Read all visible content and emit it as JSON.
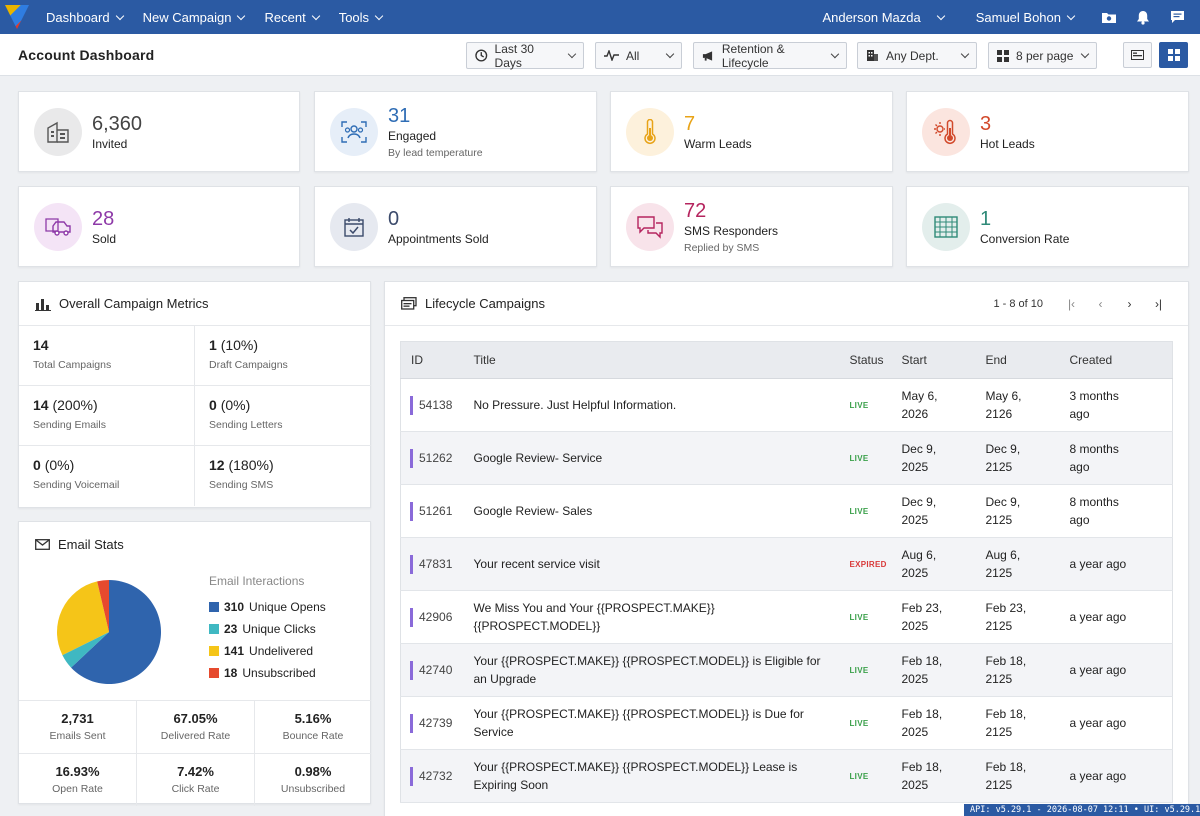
{
  "nav": {
    "items": [
      "Dashboard",
      "New Campaign",
      "Recent",
      "Tools"
    ],
    "user1": "Anderson Mazda",
    "user2": "Samuel Bohon"
  },
  "header": {
    "title": "Account Dashboard",
    "filters": {
      "date": "Last 30 Days",
      "channel": "All",
      "campaign_type": "Retention & Lifecycle",
      "department": "Any Dept.",
      "per_page": "8 per page"
    }
  },
  "stats": [
    {
      "value": "6,360",
      "label": "Invited",
      "sub": "",
      "color": "#444444",
      "icon": "building-icon"
    },
    {
      "value": "31",
      "label": "Engaged",
      "sub": "By lead temperature",
      "color": "#2f6db5",
      "icon": "people-icon"
    },
    {
      "value": "7",
      "label": "Warm Leads",
      "sub": "",
      "color": "#e8a317",
      "icon": "thermometer-icon"
    },
    {
      "value": "3",
      "label": "Hot Leads",
      "sub": "",
      "color": "#d2492b",
      "icon": "hot-thermometer-icon"
    },
    {
      "value": "28",
      "label": "Sold",
      "sub": "",
      "color": "#8e3aa8",
      "icon": "car-icon"
    },
    {
      "value": "0",
      "label": "Appointments Sold",
      "sub": "",
      "color": "#3b4a6b",
      "icon": "calendar-check-icon"
    },
    {
      "value": "72",
      "label": "SMS Responders",
      "sub": "Replied by SMS",
      "color": "#b5245e",
      "icon": "chat-icon"
    },
    {
      "value": "1",
      "label": "Conversion Rate",
      "sub": "",
      "color": "#2f8a78",
      "icon": "grid-icon"
    }
  ],
  "campaign_metrics": {
    "title": "Overall Campaign Metrics",
    "items": [
      {
        "value": "14",
        "pct": "",
        "label": "Total Campaigns"
      },
      {
        "value": "1",
        "pct": "(10%)",
        "label": "Draft Campaigns"
      },
      {
        "value": "14",
        "pct": "(200%)",
        "label": "Sending Emails"
      },
      {
        "value": "0",
        "pct": "(0%)",
        "label": "Sending Letters"
      },
      {
        "value": "0",
        "pct": "(0%)",
        "label": "Sending Voicemail"
      },
      {
        "value": "12",
        "pct": "(180%)",
        "label": "Sending SMS"
      }
    ]
  },
  "email_stats": {
    "title": "Email Stats",
    "legend_title": "Email Interactions",
    "legend": [
      {
        "value": "310",
        "label": "Unique Opens",
        "color": "#2f64ad"
      },
      {
        "value": "23",
        "label": "Unique Clicks",
        "color": "#3fb8c2"
      },
      {
        "value": "141",
        "label": "Undelivered",
        "color": "#f5c518"
      },
      {
        "value": "18",
        "label": "Unsubscribed",
        "color": "#e64a2e"
      }
    ],
    "summary": [
      {
        "value": "2,731",
        "label": "Emails Sent"
      },
      {
        "value": "67.05%",
        "label": "Delivered Rate"
      },
      {
        "value": "5.16%",
        "label": "Bounce Rate"
      },
      {
        "value": "16.93%",
        "label": "Open Rate"
      },
      {
        "value": "7.42%",
        "label": "Click Rate"
      },
      {
        "value": "0.98%",
        "label": "Unsubscribed"
      }
    ]
  },
  "chart_data": {
    "type": "pie",
    "title": "Email Interactions",
    "categories": [
      "Unique Opens",
      "Unique Clicks",
      "Undelivered",
      "Unsubscribed"
    ],
    "values": [
      310,
      23,
      141,
      18
    ],
    "colors": [
      "#2f64ad",
      "#3fb8c2",
      "#f5c518",
      "#e64a2e"
    ],
    "legend": "right"
  },
  "lifecycle": {
    "title": "Lifecycle Campaigns",
    "pager": "1 - 8 of 10",
    "columns": [
      "ID",
      "Title",
      "Status",
      "Start",
      "End",
      "Created"
    ],
    "rows": [
      {
        "id": "54138",
        "title": "No Pressure. Just Helpful Information.",
        "status": "LIVE",
        "start1": "May 6,",
        "start2": "2026",
        "end1": "May 6,",
        "end2": "2126",
        "created1": "3 months",
        "created2": "ago"
      },
      {
        "id": "51262",
        "title": "Google Review- Service",
        "status": "LIVE",
        "start1": "Dec 9,",
        "start2": "2025",
        "end1": "Dec 9,",
        "end2": "2125",
        "created1": "8 months",
        "created2": "ago"
      },
      {
        "id": "51261",
        "title": "Google Review- Sales",
        "status": "LIVE",
        "start1": "Dec 9,",
        "start2": "2025",
        "end1": "Dec 9,",
        "end2": "2125",
        "created1": "8 months",
        "created2": "ago"
      },
      {
        "id": "47831",
        "title": "Your recent service visit",
        "status": "EXPIRED",
        "start1": "Aug 6,",
        "start2": "2025",
        "end1": "Aug 6,",
        "end2": "2125",
        "created1": "a year ago",
        "created2": ""
      },
      {
        "id": "42906",
        "title": "We Miss You and Your {{PROSPECT.MAKE}} {{PROSPECT.MODEL}}",
        "status": "LIVE",
        "start1": "Feb 23,",
        "start2": "2025",
        "end1": "Feb 23,",
        "end2": "2125",
        "created1": "a year ago",
        "created2": ""
      },
      {
        "id": "42740",
        "title": "Your {{PROSPECT.MAKE}} {{PROSPECT.MODEL}} is Eligible for an Upgrade",
        "status": "LIVE",
        "start1": "Feb 18,",
        "start2": "2025",
        "end1": "Feb 18,",
        "end2": "2125",
        "created1": "a year ago",
        "created2": ""
      },
      {
        "id": "42739",
        "title": "Your {{PROSPECT.MAKE}} {{PROSPECT.MODEL}} is Due for Service",
        "status": "LIVE",
        "start1": "Feb 18,",
        "start2": "2025",
        "end1": "Feb 18,",
        "end2": "2125",
        "created1": "a year ago",
        "created2": ""
      },
      {
        "id": "42732",
        "title": "Your {{PROSPECT.MAKE}} {{PROSPECT.MODEL}} Lease is Expiring Soon",
        "status": "LIVE",
        "start1": "Feb 18,",
        "start2": "2025",
        "end1": "Feb 18,",
        "end2": "2125",
        "created1": "a year ago",
        "created2": ""
      }
    ]
  },
  "version": "API: v5.29.1 - 2026-08-07 12:11 • UI: v5.29.1"
}
